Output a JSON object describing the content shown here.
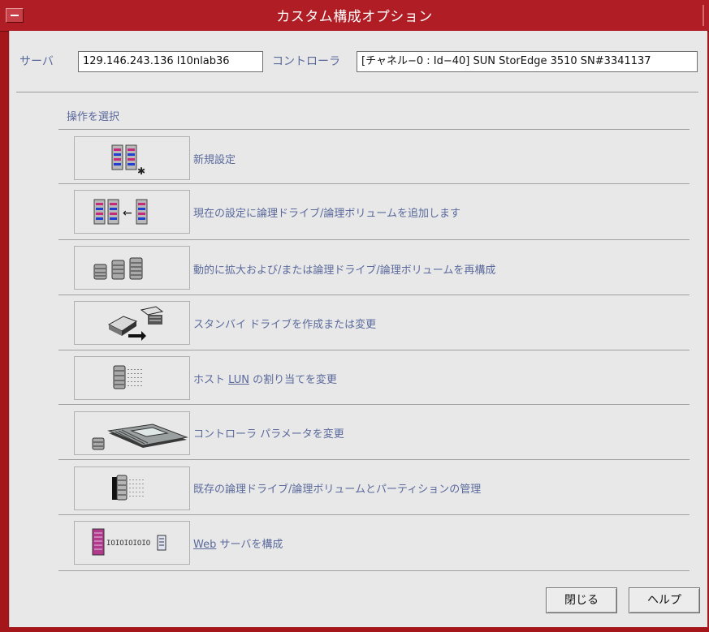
{
  "window": {
    "title": "カスタム構成オプション"
  },
  "server": {
    "label": "サーバ",
    "value": "129.146.243.136 l10nlab36"
  },
  "controller": {
    "label": "コントローラ",
    "value": "[チャネル−0 : Id−40] SUN StorEdge 3510 SN#3341137"
  },
  "section": {
    "label": "操作を選択"
  },
  "options": [
    {
      "label": "新規設定",
      "icon": "new-config-icon"
    },
    {
      "label": "現在の設定に論理ドライブ/論理ボリュームを追加します",
      "icon": "add-ld-icon"
    },
    {
      "label": "動的に拡大および/または論理ドライブ/論理ボリュームを再構成",
      "icon": "expand-reconfig-icon"
    },
    {
      "label": "スタンバイ ドライブを作成または変更",
      "icon": "standby-drive-icon"
    },
    {
      "label_prefix": "ホスト ",
      "label_underline": "LUN",
      "label_suffix": " の割り当てを変更",
      "icon": "host-lun-icon"
    },
    {
      "label": "コントローラ パラメータを変更",
      "icon": "controller-params-icon"
    },
    {
      "label": "既存の論理ドライブ/論理ボリュームとパーティションの管理",
      "icon": "manage-partitions-icon"
    },
    {
      "label_underline": "Web",
      "label_suffix": " サーバを構成",
      "icon": "web-server-icon"
    }
  ],
  "buttons": {
    "close": "閉じる",
    "help": "ヘルプ"
  }
}
